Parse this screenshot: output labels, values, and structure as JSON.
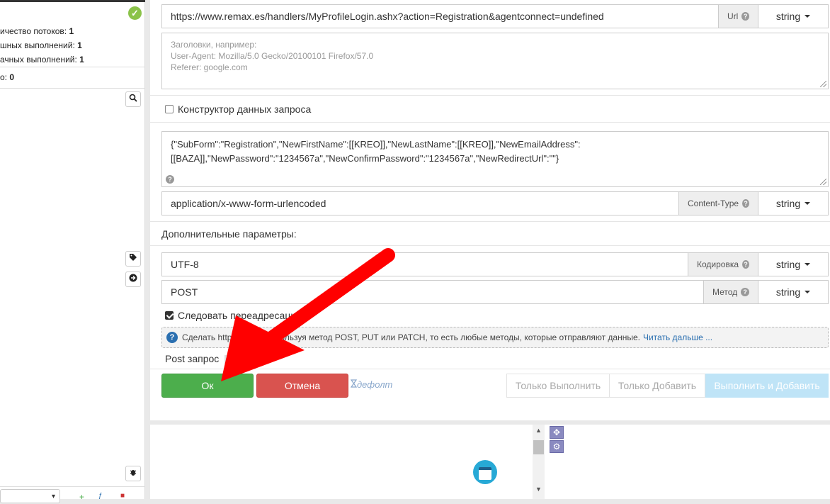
{
  "left": {
    "stats": [
      {
        "label": "ичество потоков:",
        "value": "1"
      },
      {
        "label": "шных выполнений:",
        "value": "1"
      },
      {
        "label": "ачных выполнений:",
        "value": "1"
      },
      {
        "label": "о:",
        "value": "0"
      }
    ]
  },
  "form": {
    "url": {
      "value": "https://www.remax.es/handlers/MyProfileLogin.ashx?action=Registration&agentconnect=undefined",
      "addon": "Url",
      "type": "string"
    },
    "headers_placeholder": [
      "Заголовки, например:",
      "User-Agent: Mozilla/5.0 Gecko/20100101 Firefox/57.0",
      "Referer: google.com"
    ],
    "constructor_label": "Конструктор данных запроса",
    "body_line1": "{\"SubForm\":\"Registration\",\"NewFirstName\":[[KREO]],\"NewLastName\":[[KREO]],\"NewEmailAddress\":",
    "body_line2": "[[BAZA]],\"NewPassword\":\"1234567a\",\"NewConfirmPassword\":\"1234567a\",\"NewRedirectUrl\":\"\"}",
    "content_type": {
      "value": "application/x-www-form-urlencoded",
      "addon": "Content-Type",
      "type": "string"
    },
    "extra_label": "Дополнительные параметры:",
    "encoding": {
      "value": "UTF-8",
      "addon": "Кодировка",
      "type": "string"
    },
    "method": {
      "value": "POST",
      "addon": "Метод",
      "type": "string"
    },
    "follow_redirect_label": "Следовать переадресации",
    "info_text": "Сделать http-запрос, используя метод POST, PUT или PATCH, то есть любые методы, которые отправляют данные.",
    "info_link": "Читать дальше ...",
    "action_title": "Post запрос",
    "ok_label": "Ок",
    "cancel_label": "Отмена",
    "default_label": "дефолт",
    "only_run_label": "Только Выполнить",
    "only_add_label": "Только Добавить",
    "run_add_label": "Выполнить и Добавить"
  },
  "colors": {
    "ok": "#4cae4c",
    "cancel": "#d9534f",
    "annotation_arrow": "#ff0000"
  },
  "icons": [
    "check-circle-icon",
    "search-icon",
    "tag-icon",
    "arrow-right-circle-icon",
    "bug-icon",
    "question-icon",
    "info-icon",
    "hourglass-icon",
    "expand-icon",
    "gear-icon",
    "app-window-icon"
  ]
}
